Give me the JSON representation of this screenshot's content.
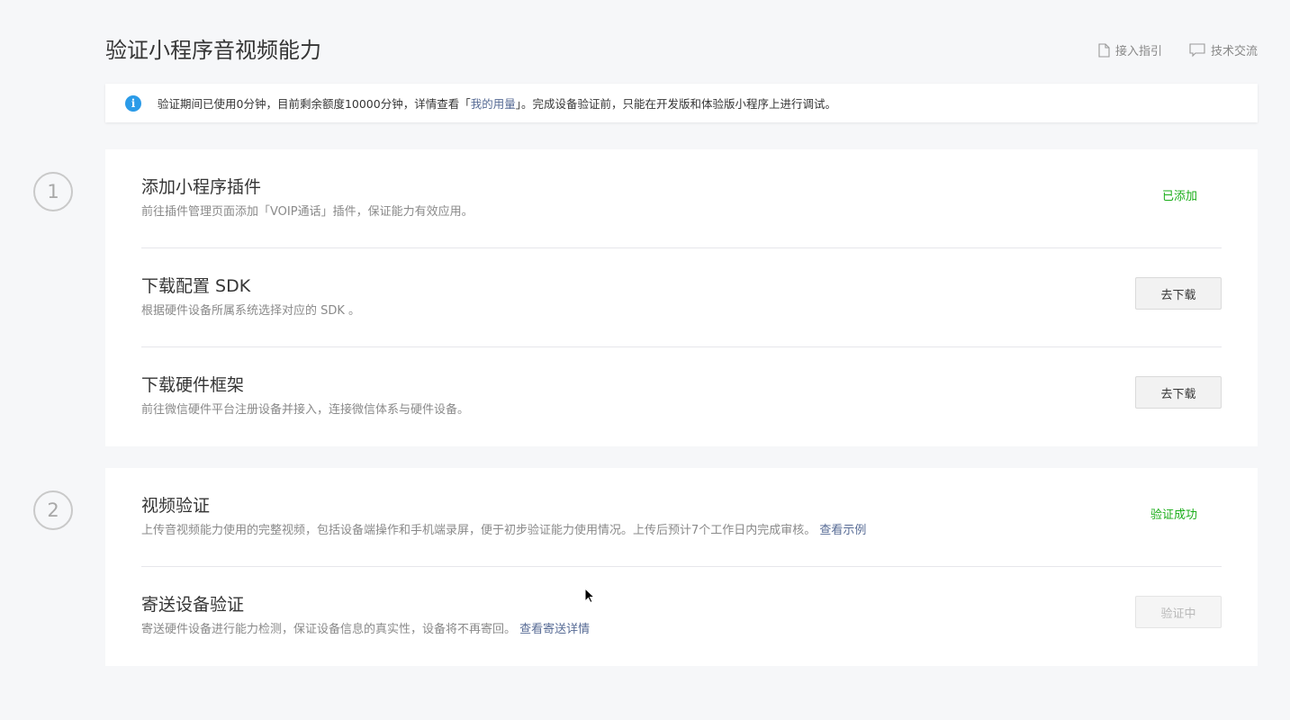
{
  "page": {
    "title": "验证小程序音视频能力",
    "header_links": [
      {
        "label": "接入指引",
        "icon": "document-icon"
      },
      {
        "label": "技术交流",
        "icon": "chat-bubble-icon"
      }
    ]
  },
  "notice": {
    "icon": "info-icon",
    "icon_glyph": "i",
    "text_before": "验证期间已使用0分钟，目前剩余额度10000分钟，详情查看「",
    "link": "我的用量",
    "text_after": "」。完成设备验证前，只能在开发版和体验版小程序上进行调试。"
  },
  "steps": [
    {
      "number": "1",
      "rows": [
        {
          "title": "添加小程序插件",
          "desc": "前往插件管理页面添加「VOIP通话」插件，保证能力有效应用。",
          "status": "已添加"
        },
        {
          "title": "下载配置 SDK",
          "desc": "根据硬件设备所属系统选择对应的 SDK 。",
          "button": "去下载"
        },
        {
          "title": "下载硬件框架",
          "desc": "前往微信硬件平台注册设备并接入，连接微信体系与硬件设备。",
          "button": "去下载"
        }
      ]
    },
    {
      "number": "2",
      "rows": [
        {
          "title": "视频验证",
          "desc": "上传音视频能力使用的完整视频，包括设备端操作和手机端录屏，便于初步验证能力使用情况。上传后预计7个工作日内完成审核。",
          "desc_link": "查看示例",
          "status": "验证成功"
        },
        {
          "title": "寄送设备验证",
          "desc": "寄送硬件设备进行能力检测，保证设备信息的真实性，设备将不再寄回。",
          "desc_link": "查看寄送详情",
          "button": "验证中",
          "button_disabled": true
        }
      ]
    }
  ],
  "colors": {
    "background": "#f6f7f9",
    "success": "#1aad19",
    "link": "#576b95",
    "info": "#2b9be8"
  }
}
